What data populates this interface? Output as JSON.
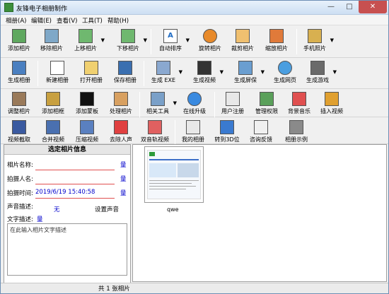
{
  "window": {
    "title": "友锋电子相册制作"
  },
  "menu": [
    "相册(A)",
    "编辑(E)",
    "查看(V)",
    "工具(T)",
    "帮助(H)"
  ],
  "toolbar1": [
    "添加相片",
    "移除相片",
    "上移相片",
    "下移相片",
    "自动排序",
    "旋转相片",
    "裁剪相片",
    "缩放相片",
    "手机照片"
  ],
  "toolbar2": [
    "生成相册",
    "新建相册",
    "打开相册",
    "保存相册",
    "生成 EXE",
    "生成视频",
    "生成屏保",
    "生成网页",
    "生成游戏"
  ],
  "toolbar3": [
    "调整相片",
    "添加相框",
    "添加蒙板",
    "处理相片",
    "相关工具",
    "在线升级",
    "用户注册",
    "管理权限",
    "背景音乐",
    "插入视频"
  ],
  "toolbar4": [
    "视频截取",
    "合并视频",
    "压缩视频",
    "去除人声",
    "双音轨视频",
    "我的相册",
    "转到3D位",
    "咨询反馈",
    "相册示例"
  ],
  "info_panel": {
    "title": "选定相片信息",
    "name_label": "相片名称:",
    "photographer_label": "拍摄人名:",
    "time_label": "拍摄时间:",
    "time_value": "2019/6/19 15:40:58",
    "sound_label": "声音描述:",
    "sound_value": "无",
    "set_sound": "设置声音",
    "text_label": "文字描述:",
    "edit_mark": "量",
    "desc_placeholder": "在此输入相片文字描述"
  },
  "thumbnail": {
    "caption": "qwe"
  },
  "status": {
    "text": "共 1 张相片"
  }
}
